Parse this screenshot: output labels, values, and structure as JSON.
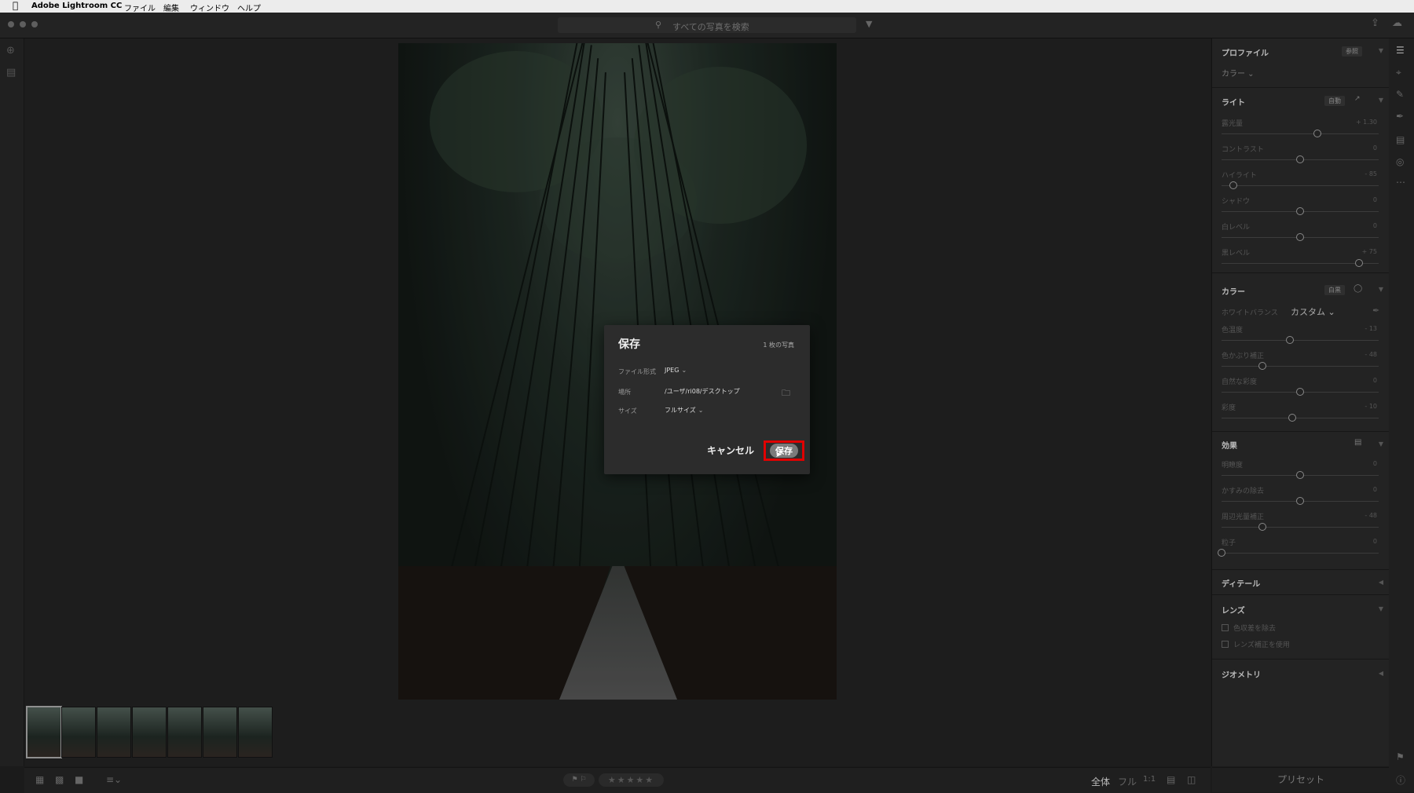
{
  "menubar": {
    "app_name": "Adobe Lightroom CC",
    "items": [
      "ファイル",
      "編集",
      "ウィンドウ",
      "ヘルプ"
    ]
  },
  "search": {
    "placeholder": "すべての写真を検索"
  },
  "dialog": {
    "title": "保存",
    "photo_count": "1 枚の写真",
    "format_label": "ファイル形式",
    "format_value": "JPEG",
    "location_label": "場所",
    "location_value": "/ユーザ/ri08/デスクトップ",
    "size_label": "サイズ",
    "size_value": "フルサイズ",
    "cancel_label": "キャンセル",
    "save_label": "保存"
  },
  "bottombar": {
    "zoom_options": [
      "全体",
      "フル",
      "1:1"
    ]
  },
  "panel": {
    "profile": {
      "title": "プロファイル",
      "browse_label": "参照",
      "value": "カラー"
    },
    "light": {
      "title": "ライト",
      "auto_label": "自動",
      "sliders": [
        {
          "label": "露光量",
          "value": "+ 1.30",
          "pos": 0.61
        },
        {
          "label": "コントラスト",
          "value": "0",
          "pos": 0.5
        },
        {
          "label": "ハイライト",
          "value": "- 85",
          "pos": 0.075
        },
        {
          "label": "シャドウ",
          "value": "0",
          "pos": 0.5
        },
        {
          "label": "白レベル",
          "value": "0",
          "pos": 0.5
        },
        {
          "label": "黒レベル",
          "value": "+ 75",
          "pos": 0.875
        }
      ]
    },
    "color": {
      "title": "カラー",
      "bw_label": "白黒",
      "wb_label": "ホワイトバランス",
      "wb_value": "カスタム",
      "sliders": [
        {
          "label": "色温度",
          "value": "- 13",
          "pos": 0.435
        },
        {
          "label": "色かぶり補正",
          "value": "- 48",
          "pos": 0.26
        },
        {
          "label": "自然な彩度",
          "value": "0",
          "pos": 0.5
        },
        {
          "label": "彩度",
          "value": "- 10",
          "pos": 0.45
        }
      ]
    },
    "effects": {
      "title": "効果",
      "sliders": [
        {
          "label": "明瞭度",
          "value": "0",
          "pos": 0.5
        },
        {
          "label": "かすみの除去",
          "value": "0",
          "pos": 0.5
        },
        {
          "label": "周辺光量補正",
          "value": "- 48",
          "pos": 0.26
        },
        {
          "label": "粒子",
          "value": "0",
          "pos": 0.0
        }
      ]
    },
    "detail": {
      "title": "ディテール"
    },
    "lens": {
      "title": "レンズ",
      "opt1": "色収差を除去",
      "opt2": "レンズ補正を使用"
    },
    "geometry": {
      "title": "ジオメトリ"
    },
    "presets_label": "プリセット"
  }
}
